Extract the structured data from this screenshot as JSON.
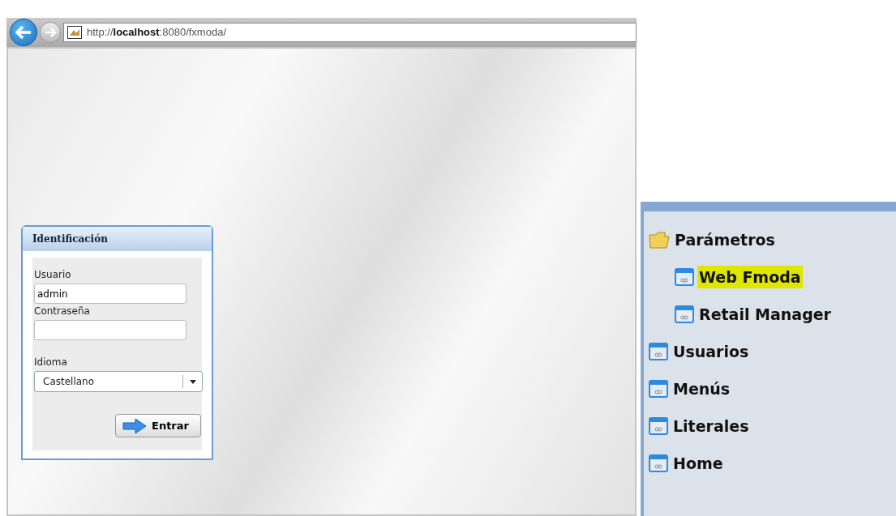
{
  "browser": {
    "address": "http://**localhost**:8080/fxmoda/"
  },
  "login": {
    "title": "Identificación",
    "fields": [
      {
        "kind": "text",
        "label": "Usuario",
        "value": "admin"
      },
      {
        "kind": "password",
        "label": "Contraseña"
      },
      {
        "kind": "select",
        "label": "Idioma",
        "value": "Castellano"
      }
    ],
    "button": "Entrar"
  },
  "tree": [
    {
      "kind": "folder",
      "label": "Parámetros",
      "selected": false,
      "children": [
        {
          "kind": "page",
          "label": "Web Fmoda",
          "selected": true
        },
        {
          "kind": "page",
          "label": "Retail Manager",
          "selected": false
        }
      ]
    },
    {
      "kind": "page",
      "label": "Usuarios",
      "selected": false
    },
    {
      "kind": "page",
      "label": "Menús",
      "selected": false
    },
    {
      "kind": "page",
      "label": "Literales",
      "selected": false
    },
    {
      "kind": "page",
      "label": "Home",
      "selected": false
    }
  ]
}
